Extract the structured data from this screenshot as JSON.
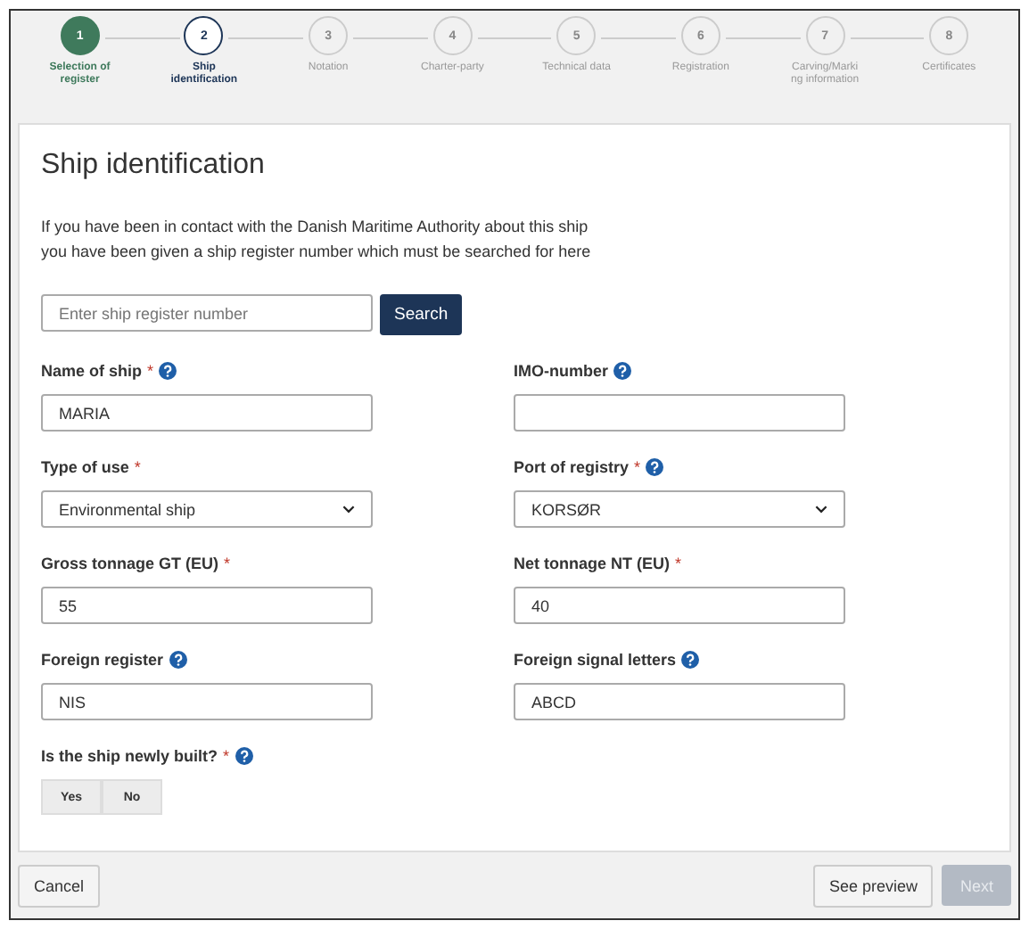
{
  "steps": [
    {
      "number": "1",
      "label": "Selection of register",
      "done": true,
      "selected": false
    },
    {
      "number": "2",
      "label": "Ship identification",
      "done": false,
      "selected": true
    },
    {
      "number": "3",
      "label": "Notation",
      "done": false,
      "selected": false
    },
    {
      "number": "4",
      "label": "Charter-party",
      "done": false,
      "selected": false
    },
    {
      "number": "5",
      "label": "Technical data",
      "done": false,
      "selected": false
    },
    {
      "number": "6",
      "label": "Registration",
      "done": false,
      "selected": false
    },
    {
      "number": "7",
      "label": "Carving/Marki ng information",
      "done": false,
      "selected": false
    },
    {
      "number": "8",
      "label": "Certificates",
      "done": false,
      "selected": false
    }
  ],
  "title": "Ship identification",
  "intro": [
    "If you have been in contact with the Danish Maritime Authority about this ship",
    "you have been given a ship register number which must be searched for here"
  ],
  "search": {
    "placeholder": "Enter ship register number",
    "button": "Search"
  },
  "fields": [
    {
      "kind": "text",
      "label": "Name of ship",
      "required_mark": "*",
      "help": true,
      "value": "MARIA"
    },
    {
      "kind": "text",
      "label": "IMO-number",
      "help": true
    },
    {
      "kind": "select",
      "label": "Type of use",
      "required_mark": "*",
      "help": false,
      "value": "Environmental ship"
    },
    {
      "kind": "select",
      "label": "Port of registry",
      "required_mark": "*",
      "help": true,
      "value": "KORSØR"
    },
    {
      "kind": "text",
      "label": "Gross tonnage GT (EU)",
      "required_mark": "*",
      "help": false,
      "value": "55"
    },
    {
      "kind": "text",
      "label": "Net tonnage NT (EU)",
      "required_mark": "*",
      "help": false,
      "value": "40"
    },
    {
      "kind": "text",
      "label": "Foreign register",
      "help": true,
      "value": "NIS"
    },
    {
      "kind": "text",
      "label": "Foreign signal letters",
      "help": true,
      "value": "ABCD"
    }
  ],
  "newly_built": {
    "label": "Is the ship newly built?",
    "required_mark": "*",
    "help": true,
    "options": [
      {
        "label": "Yes",
        "selected": false
      },
      {
        "label": "No",
        "selected": false
      }
    ]
  },
  "footer": {
    "cancel": "Cancel",
    "preview": "See preview",
    "next": "Next",
    "next_disabled": true
  }
}
